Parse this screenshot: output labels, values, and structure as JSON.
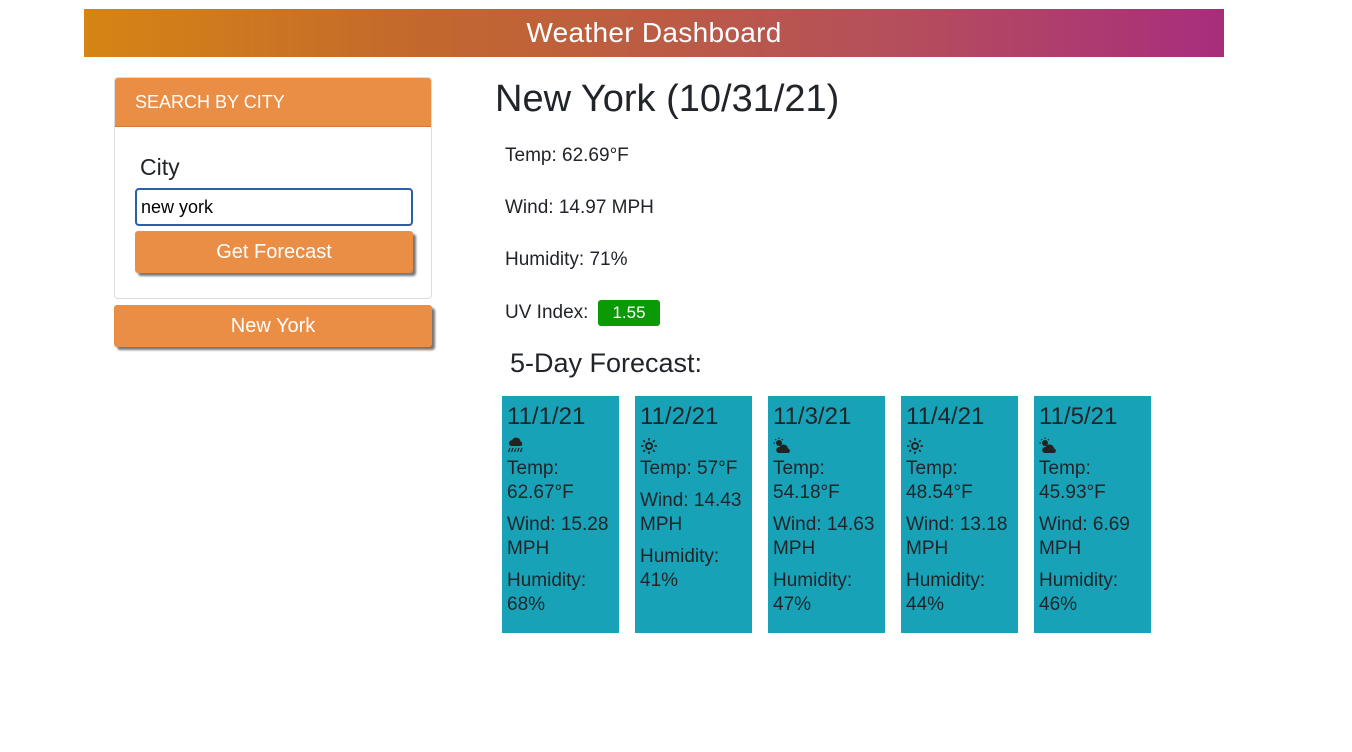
{
  "header": {
    "title": "Weather Dashboard",
    "gradient": [
      "#d58514",
      "#a82d7d"
    ]
  },
  "search": {
    "header": "SEARCH BY CITY",
    "label": "City",
    "input_value": "new york",
    "button_label": "Get Forecast"
  },
  "history": [
    {
      "label": "New York"
    }
  ],
  "current": {
    "heading": "New York (10/31/21)",
    "temp": "Temp: 62.69°F",
    "wind": "Wind: 14.97 MPH",
    "humidity": "Humidity: 71%",
    "uv_label": "UV Index:",
    "uv_value": "1.55",
    "uv_color": "#0a9a05"
  },
  "forecast": {
    "heading": "5-Day Forecast:",
    "card_color": "#17a2b8",
    "days": [
      {
        "date": "11/1/21",
        "icon": "rain-icon",
        "temp": "Temp: 62.67°F",
        "wind": "Wind: 15.28 MPH",
        "humidity": "Humidity: 68%"
      },
      {
        "date": "11/2/21",
        "icon": "sun-icon",
        "temp": "Temp: 57°F",
        "wind": "Wind: 14.43 MPH",
        "humidity": "Humidity: 41%"
      },
      {
        "date": "11/3/21",
        "icon": "partly-cloudy-icon",
        "temp": "Temp: 54.18°F",
        "wind": "Wind: 14.63 MPH",
        "humidity": "Humidity: 47%"
      },
      {
        "date": "11/4/21",
        "icon": "sun-icon",
        "temp": "Temp: 48.54°F",
        "wind": "Wind: 13.18 MPH",
        "humidity": "Humidity: 44%"
      },
      {
        "date": "11/5/21",
        "icon": "partly-cloudy-icon",
        "temp": "Temp: 45.93°F",
        "wind": "Wind: 6.69 MPH",
        "humidity": "Humidity: 46%"
      }
    ]
  }
}
